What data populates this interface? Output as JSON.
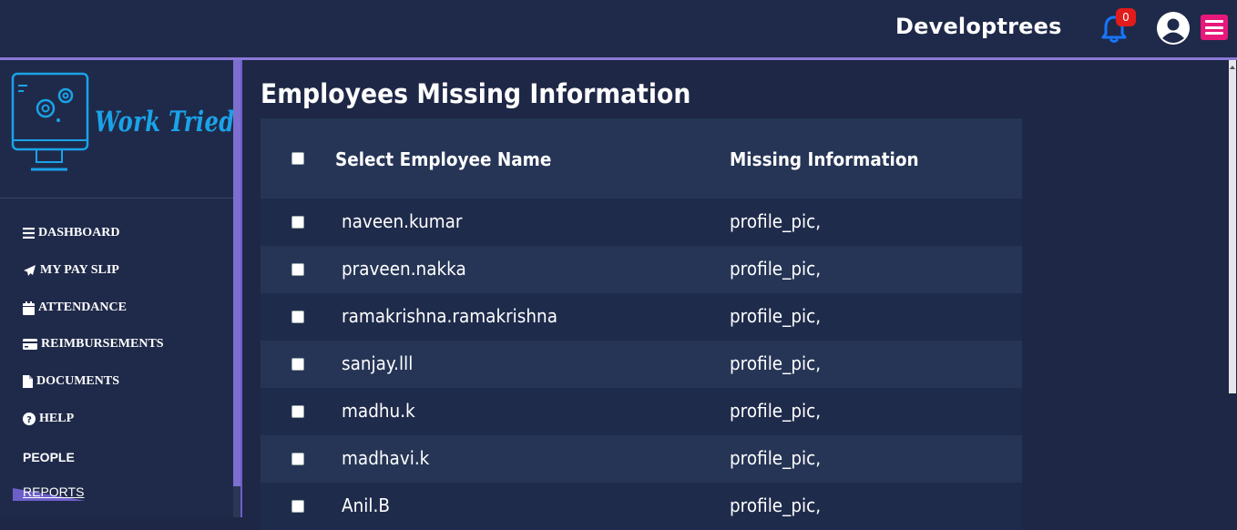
{
  "header": {
    "brand": "Developtrees",
    "notification_count": "0",
    "accent_color": "#e6197a",
    "bell_color": "#1677ff"
  },
  "logo": {
    "text": "Work Tried"
  },
  "sidebar": {
    "items": [
      {
        "label": "DASHBOARD",
        "icon": "bars-icon"
      },
      {
        "label": "MY PAY SLIP",
        "icon": "paper-plane-icon"
      },
      {
        "label": "ATTENDANCE",
        "icon": "calendar-icon"
      },
      {
        "label": "REIMBURSEMENTS",
        "icon": "credit-card-icon"
      },
      {
        "label": "DOCUMENTS",
        "icon": "file-icon"
      },
      {
        "label": "HELP",
        "icon": "question-circle-icon"
      },
      {
        "label": "PEOPLE",
        "icon": ""
      },
      {
        "label": "REPORTS",
        "icon": ""
      }
    ]
  },
  "main": {
    "title": "Employees Missing Information",
    "columns": [
      "Select Employee Name",
      "Missing Information"
    ],
    "rows": [
      {
        "name": "naveen.kumar",
        "missing": "profile_pic,"
      },
      {
        "name": "praveen.nakka",
        "missing": "profile_pic,"
      },
      {
        "name": "ramakrishna.ramakrishna",
        "missing": "profile_pic,"
      },
      {
        "name": "sanjay.lll",
        "missing": "profile_pic,"
      },
      {
        "name": "madhu.k",
        "missing": "profile_pic,"
      },
      {
        "name": "madhavi.k",
        "missing": "profile_pic,"
      },
      {
        "name": "Anil.B",
        "missing": "profile_pic,"
      }
    ]
  }
}
